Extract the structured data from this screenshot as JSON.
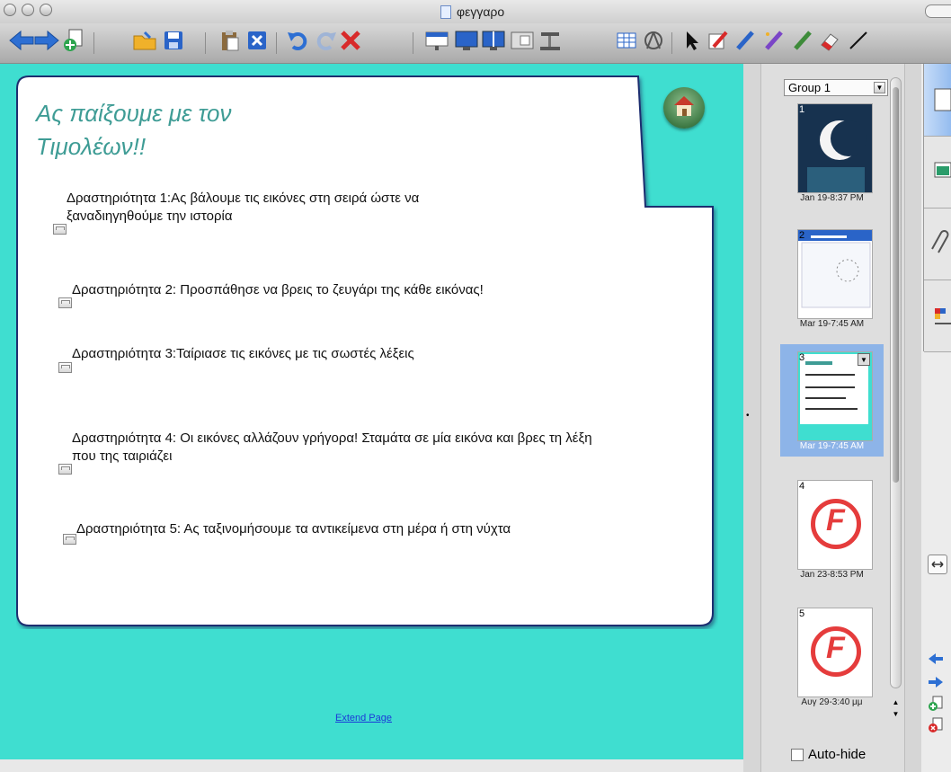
{
  "window": {
    "title": "φεγγαρο"
  },
  "toolbar": {
    "items": [
      "back-icon",
      "forward-icon",
      "add-page-icon",
      "open-folder-icon",
      "save-icon",
      "paste-icon",
      "clear-page-icon",
      "undo-icon",
      "redo-icon",
      "delete-icon",
      "screen-shade-icon",
      "full-screen-icon",
      "dual-display-icon",
      "screen-capture-icon",
      "document-camera-icon",
      "table-icon",
      "properties-icon",
      "select-icon",
      "pen-icon",
      "creative-pen-icon",
      "magic-pen-icon",
      "shape-recognition-pen-icon",
      "eraser-icon",
      "line-icon"
    ]
  },
  "page": {
    "title_line1": "Ας παίξουμε με τον",
    "title_line2": "Τιμολέων!!",
    "activities": [
      {
        "line1": "Δραστηριότητα 1:Ας βάλουμε τις εικόνες στη σειρά ώστε να",
        "line2": "ξαναδιηγηθούμε την ιστορία"
      },
      {
        "line1": "Δραστηριότητα 2: Προσπάθησε  να βρεις  το ζευγάρι της κάθε εικόνας!",
        "line2": ""
      },
      {
        "line1": "Δραστηριότητα 3:Ταίριασε τις εικόνες με τις σωστές λέξεις",
        "line2": ""
      },
      {
        "line1": "Δραστηριότητα 4: Οι εικόνες αλλάζουν γρήγορα! Σταμάτα σε μία εικόνα και βρες τη λέξη",
        "line2": "που της ταιριάζει"
      },
      {
        "line1": "Δραστηριότητα 5:  Ας ταξινομήσουμε τα αντικείμενα στη μέρα ή στη νύχτα",
        "line2": ""
      }
    ],
    "extend_link": "Extend Page",
    "colors": {
      "canvas": "#3fded0",
      "title": "#3e9c95"
    }
  },
  "sorter": {
    "group": "Group 1",
    "autohide": "Auto-hide",
    "pages": [
      {
        "num": "1",
        "date": "Jan 19-8:37 PM",
        "selected": false
      },
      {
        "num": "2",
        "date": "Mar 19-7:45 AM",
        "selected": false
      },
      {
        "num": "3",
        "date": "Mar 19-7:45 AM",
        "selected": true
      },
      {
        "num": "4",
        "date": "Jan 23-8:53 PM",
        "selected": false
      },
      {
        "num": "5",
        "date": "Αυγ 29-3:40 μμ",
        "selected": false
      }
    ]
  },
  "sidebar_tabs": [
    "page-sorter-tab",
    "gallery-tab",
    "attachments-tab",
    "properties-tab"
  ]
}
